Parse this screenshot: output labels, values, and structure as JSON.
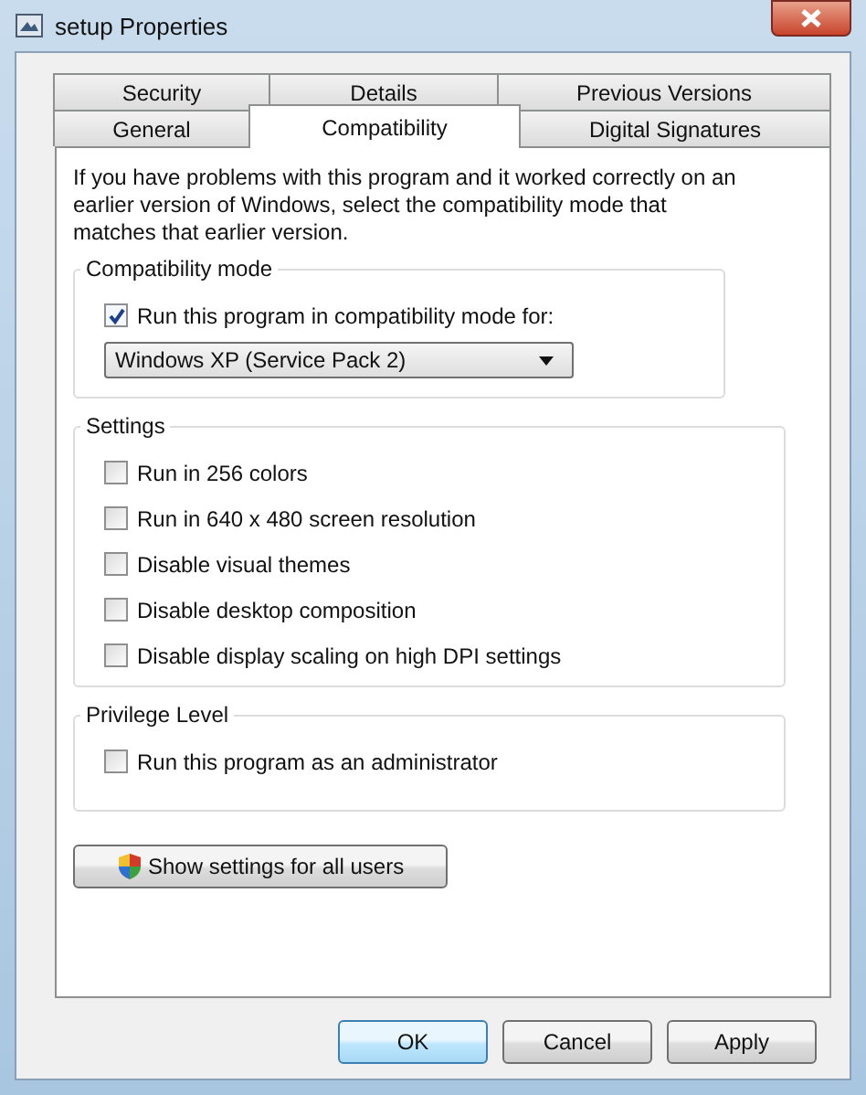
{
  "window": {
    "title": "setup Properties"
  },
  "tab_rows": [
    {
      "tabs": [
        {
          "label": "Security",
          "selected": false
        },
        {
          "label": "Details",
          "selected": false
        },
        {
          "label": "Previous Versions",
          "selected": false
        }
      ]
    },
    {
      "tabs": [
        {
          "label": "General",
          "selected": false
        },
        {
          "label": "Compatibility",
          "selected": true
        },
        {
          "label": "Digital Signatures",
          "selected": false
        }
      ]
    }
  ],
  "intro": "If you have problems with this program and it worked correctly on an earlier version of Windows, select the compatibility mode that matches that earlier version.",
  "compatibility_mode": {
    "title": "Compatibility mode",
    "checkbox": {
      "label": "Run this program in compatibility mode for:",
      "checked": true
    },
    "dropdown": {
      "value": "Windows XP (Service Pack 2)"
    }
  },
  "settings": {
    "title": "Settings",
    "options": [
      {
        "label": "Run in 256 colors",
        "checked": false
      },
      {
        "label": "Run in 640 x 480 screen resolution",
        "checked": false
      },
      {
        "label": "Disable visual themes",
        "checked": false
      },
      {
        "label": "Disable desktop composition",
        "checked": false
      },
      {
        "label": "Disable display scaling on high DPI settings",
        "checked": false
      }
    ]
  },
  "privilege_level": {
    "title": "Privilege Level",
    "options": [
      {
        "label": "Run this program as an administrator",
        "checked": false
      }
    ]
  },
  "show_settings_button": "Show settings for all users",
  "buttons": [
    {
      "label": "OK",
      "default": true
    },
    {
      "label": "Cancel",
      "default": false
    },
    {
      "label": "Apply",
      "default": false
    }
  ]
}
